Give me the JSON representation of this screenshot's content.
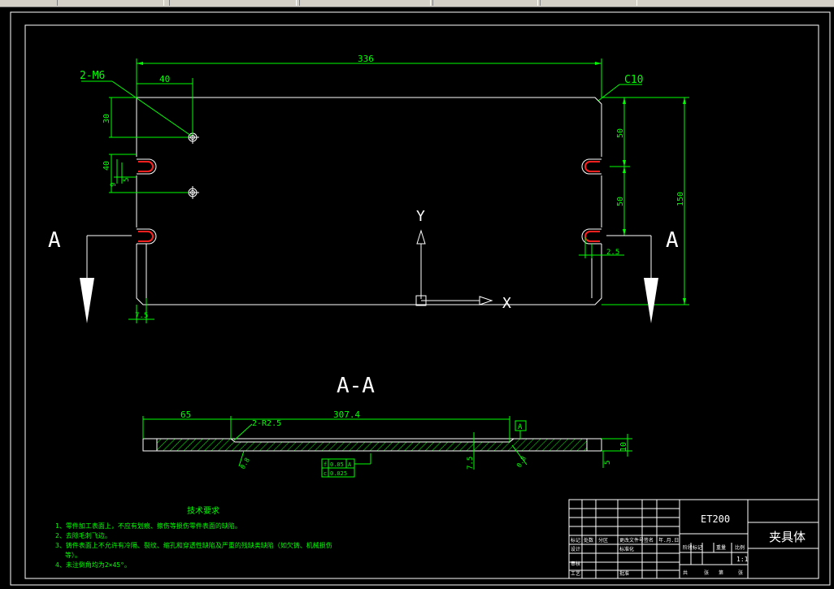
{
  "dimensions": {
    "overall_length": "336",
    "hole_offset_x": "40",
    "hole_offset_y": "30",
    "slot_offset": "40",
    "slot_gap": "5",
    "slot_small": "9",
    "right_pitch_1": "50",
    "right_pitch_2": "50",
    "overall_height": "150",
    "slot_depth": "2.5",
    "edge_thickness": "7.5"
  },
  "callouts": {
    "threads": "2-M6",
    "chamfer": "C10",
    "y_axis": "Y",
    "x_axis": "X",
    "section_mark_left": "A",
    "section_mark_right": "A",
    "section_title": "A-A"
  },
  "section": {
    "dim_left": "65",
    "dim_span": "307.4",
    "radius": "2-R2.5",
    "thickness": "10",
    "step": "5",
    "depth": "7.5",
    "angle_left": "0.8",
    "angle_right": "0.8",
    "datum": "A",
    "tolerances": [
      {
        "symbol": "f",
        "value": "0.05",
        "datum": "A"
      },
      {
        "symbol": "c",
        "value": "0.025",
        "datum": ""
      }
    ]
  },
  "notes": {
    "title": "技术要求",
    "items": [
      "1、零件加工表面上，不应有划痕、擦伤等损伤零件表面的缺陷。",
      "2、去除毛刺飞边。",
      "3、铸件表面上不允许有冷隔、裂纹、缩孔和穿透性缺陷及严重的残缺类缺陷（如欠铸、机械损伤",
      "等）。",
      "4、未注倒角均为2×45°。"
    ]
  },
  "title_block": {
    "model": "ET200",
    "part_name": "夹具体",
    "scale": "1:1",
    "labels": {
      "mark": "标记",
      "count": "处数",
      "zone": "分区",
      "doc_no": "更改文件号",
      "signature": "签名",
      "date": "年.月.日",
      "design": "设计",
      "standard": "标准化",
      "review": "审核",
      "process": "工艺",
      "approve": "批准",
      "stage_mark": "阶段标记",
      "weight": "重量",
      "ratio": "比例",
      "total": "共",
      "sheets": "张",
      "page": "第",
      "sheet": "张"
    }
  }
}
